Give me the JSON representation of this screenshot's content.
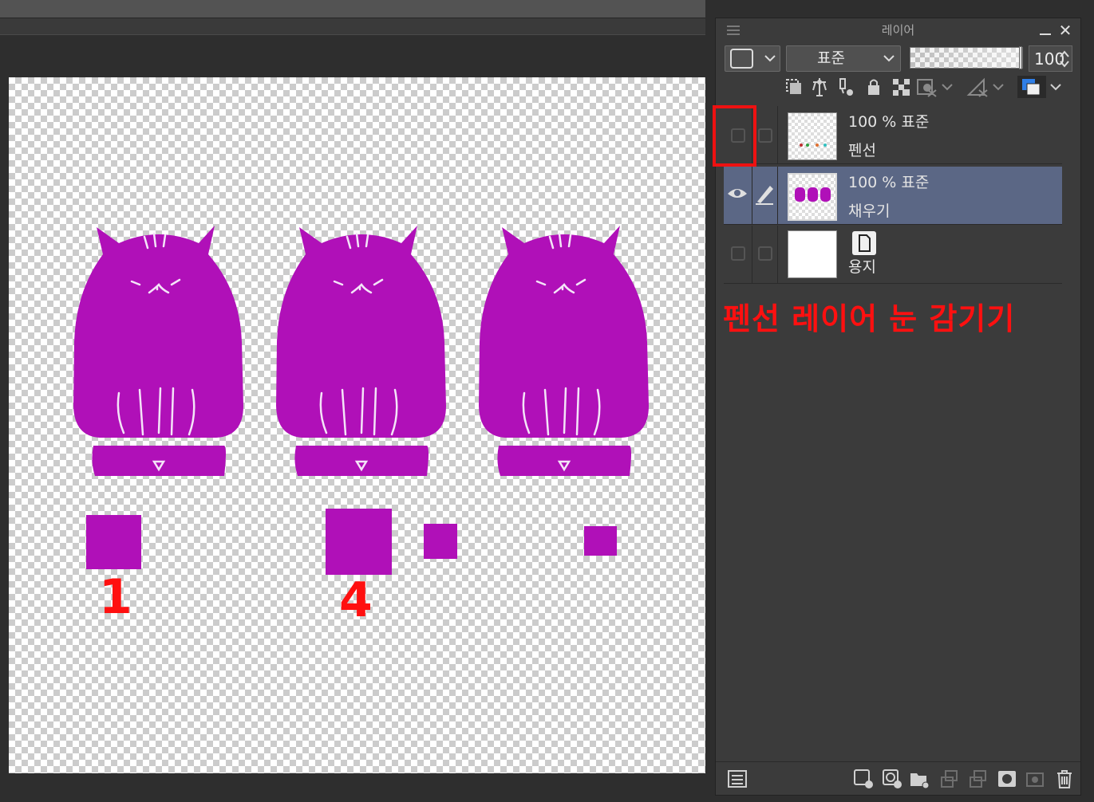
{
  "panel": {
    "title": "레이어",
    "blend_mode": "표준",
    "opacity_value": "100",
    "opacity_fraction": 1.0
  },
  "layers": [
    {
      "name": "펜선",
      "info": "100 % 표준",
      "visible": false,
      "selected": false
    },
    {
      "name": "채우기",
      "info": "100 % 표준",
      "visible": true,
      "selected": true
    },
    {
      "name": "용지",
      "info": "",
      "visible": false,
      "selected": false
    }
  ],
  "annotation": {
    "text": "펜선 레이어 눈 감기기",
    "color": "#ff1010"
  },
  "canvas": {
    "labels": [
      "1",
      "4"
    ],
    "fill_color": "#b010b8",
    "label_color": "#ff1010"
  },
  "icons": {
    "toolbar": [
      "clip-icon",
      "reference-icon",
      "draft-icon",
      "lock-icon",
      "transparency-lock-icon",
      "mask-icon",
      "ruler-icon",
      "layer-color-icon"
    ],
    "bottom": [
      "layer-property-icon",
      "new-raster-icon",
      "new-vector-icon",
      "new-folder-icon",
      "merge-down-icon",
      "merge-visible-icon",
      "mask-add-icon",
      "copy-layer-icon",
      "delete-icon"
    ]
  }
}
